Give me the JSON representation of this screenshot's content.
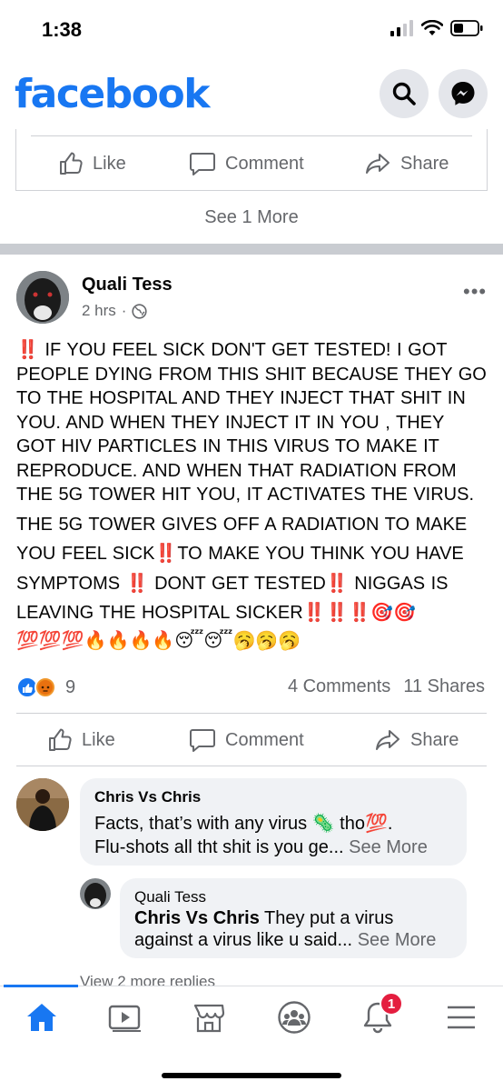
{
  "status": {
    "time": "1:38"
  },
  "header": {
    "logo": "facebook",
    "search_icon": "search-icon",
    "messenger_icon": "messenger-icon"
  },
  "previous_post": {
    "actions": {
      "like": "Like",
      "comment": "Comment",
      "share": "Share"
    },
    "see_more": "See 1 More"
  },
  "post": {
    "author": "Quali Tess",
    "time": "2 hrs",
    "audience_icon": "globe-icon",
    "text_lines": [
      "‼️ IF YOU FEEL SICK DON'T GET TESTED! I GOT",
      "PEOPLE DYING FROM THIS SHIT BECAUSE THEY GO",
      "TO THE HOSPITAL AND THEY INJECT THAT SHIT IN",
      "YOU. AND WHEN THEY INJECT IT IN YOU , THEY",
      "GOT HIV PARTICLES IN THIS VIRUS TO MAKE IT",
      "REPRODUCE. AND WHEN THAT RADIATION FROM",
      "THE 5G TOWER HIT YOU, IT ACTIVATES THE VIRUS.",
      "THE 5G TOWER GIVES OFF A RADIATION TO MAKE",
      "YOU FEEL SICK‼️TO MAKE YOU THINK YOU HAVE",
      "SYMPTOMS ‼️ DONT GET TESTED‼️ NIGGAS IS",
      "LEAVING THE HOSPITAL SICKER‼️‼️‼️🎯🎯",
      "💯💯💯🔥🔥🔥🔥😴😴🥱🥱🥱"
    ],
    "reaction_count": "9",
    "comments_count": "4 Comments",
    "shares_count": "11 Shares",
    "actions": {
      "like": "Like",
      "comment": "Comment",
      "share": "Share"
    }
  },
  "comments": [
    {
      "author": "Chris Vs Chris",
      "line1": "Facts, that’s with any virus 🦠 tho💯.",
      "line2": "Flu-shots all tht shit is you ge...",
      "see_more": "See More"
    }
  ],
  "reply": {
    "author": "Quali Tess",
    "mention": "Chris Vs Chris",
    "line1": "They put a virus",
    "line2": "against a virus like u said...",
    "see_more": "See More"
  },
  "view_replies": "View 2 more replies",
  "tabbar": {
    "notification_badge": "1",
    "accent": "#1877f2"
  },
  "colors": {
    "brand": "#1877f2",
    "secondary_text": "#65676b",
    "badge": "#e41e3f"
  }
}
